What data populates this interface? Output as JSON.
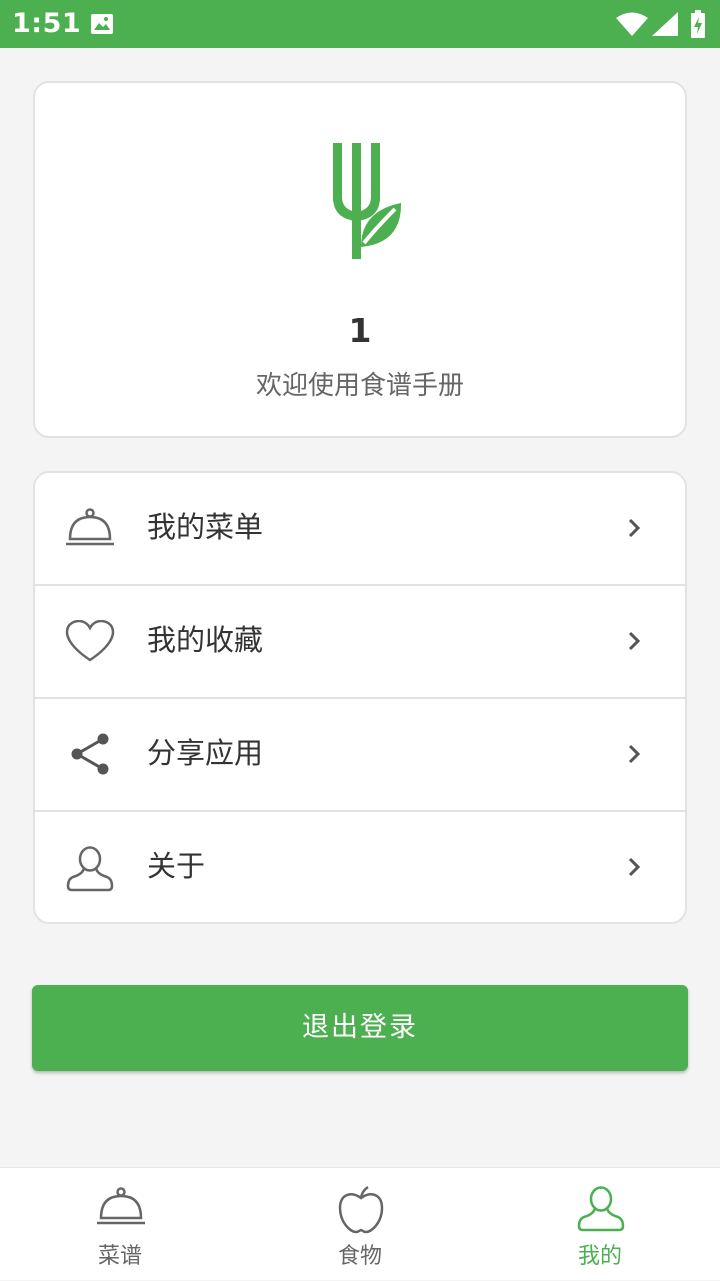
{
  "status_bar": {
    "time": "1:51",
    "icons": [
      "image-icon",
      "wifi-icon",
      "signal-icon",
      "battery-icon"
    ]
  },
  "profile": {
    "logo_icon": "fork-leaf-logo",
    "username": "1",
    "welcome": "欢迎使用食谱手册"
  },
  "menu": {
    "items": [
      {
        "label": "我的菜单",
        "icon": "cloche-icon"
      },
      {
        "label": "我的收藏",
        "icon": "heart-icon"
      },
      {
        "label": "分享应用",
        "icon": "share-icon"
      },
      {
        "label": "关于",
        "icon": "person-icon"
      }
    ]
  },
  "logout": {
    "label": "退出登录"
  },
  "bottom_nav": {
    "items": [
      {
        "label": "菜谱",
        "icon": "cloche-icon",
        "active": false
      },
      {
        "label": "食物",
        "icon": "apple-icon",
        "active": false
      },
      {
        "label": "我的",
        "icon": "person-icon",
        "active": true
      }
    ]
  },
  "colors": {
    "accent": "#4caf50",
    "background": "#f4f4f4",
    "text": "#333333",
    "muted": "#666666"
  }
}
